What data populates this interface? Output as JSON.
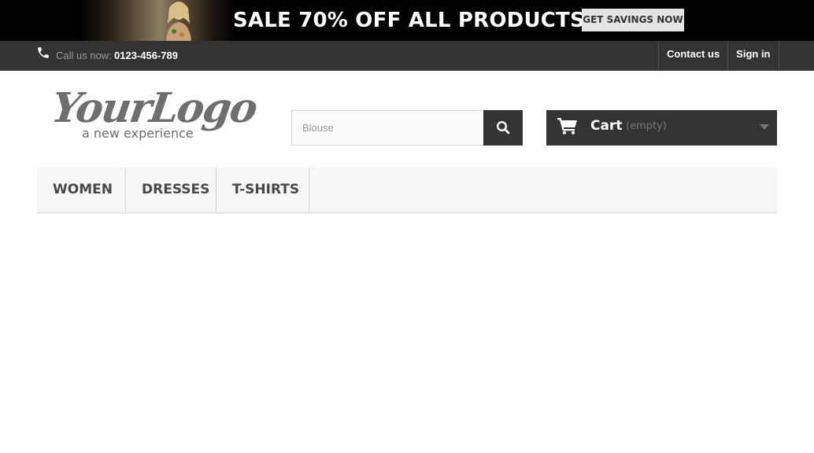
{
  "promo": {
    "title": "SALE 70% OFF ALL PRODUCTS",
    "button": "GET SAVINGS NOW"
  },
  "topbar": {
    "call_label": "Call us now:",
    "phone": "0123-456-789",
    "contact": "Contact us",
    "signin": "Sign in"
  },
  "logo": {
    "main": "YourLogo",
    "tagline": "a new experience"
  },
  "search": {
    "placeholder": "Blouse",
    "value": ""
  },
  "cart": {
    "label": "Cart",
    "status": "(empty)"
  },
  "menu": {
    "items": [
      "WOMEN",
      "DRESSES",
      "T-SHIRTS"
    ]
  },
  "colors": {
    "dark_bar": "#333333",
    "menu_bg": "#f6f6f6",
    "logo_gray": "#6e6e6e"
  },
  "icons": {
    "phone": "phone-icon",
    "search": "search-icon",
    "cart": "shopping-cart-icon",
    "caret": "caret-down-icon"
  }
}
